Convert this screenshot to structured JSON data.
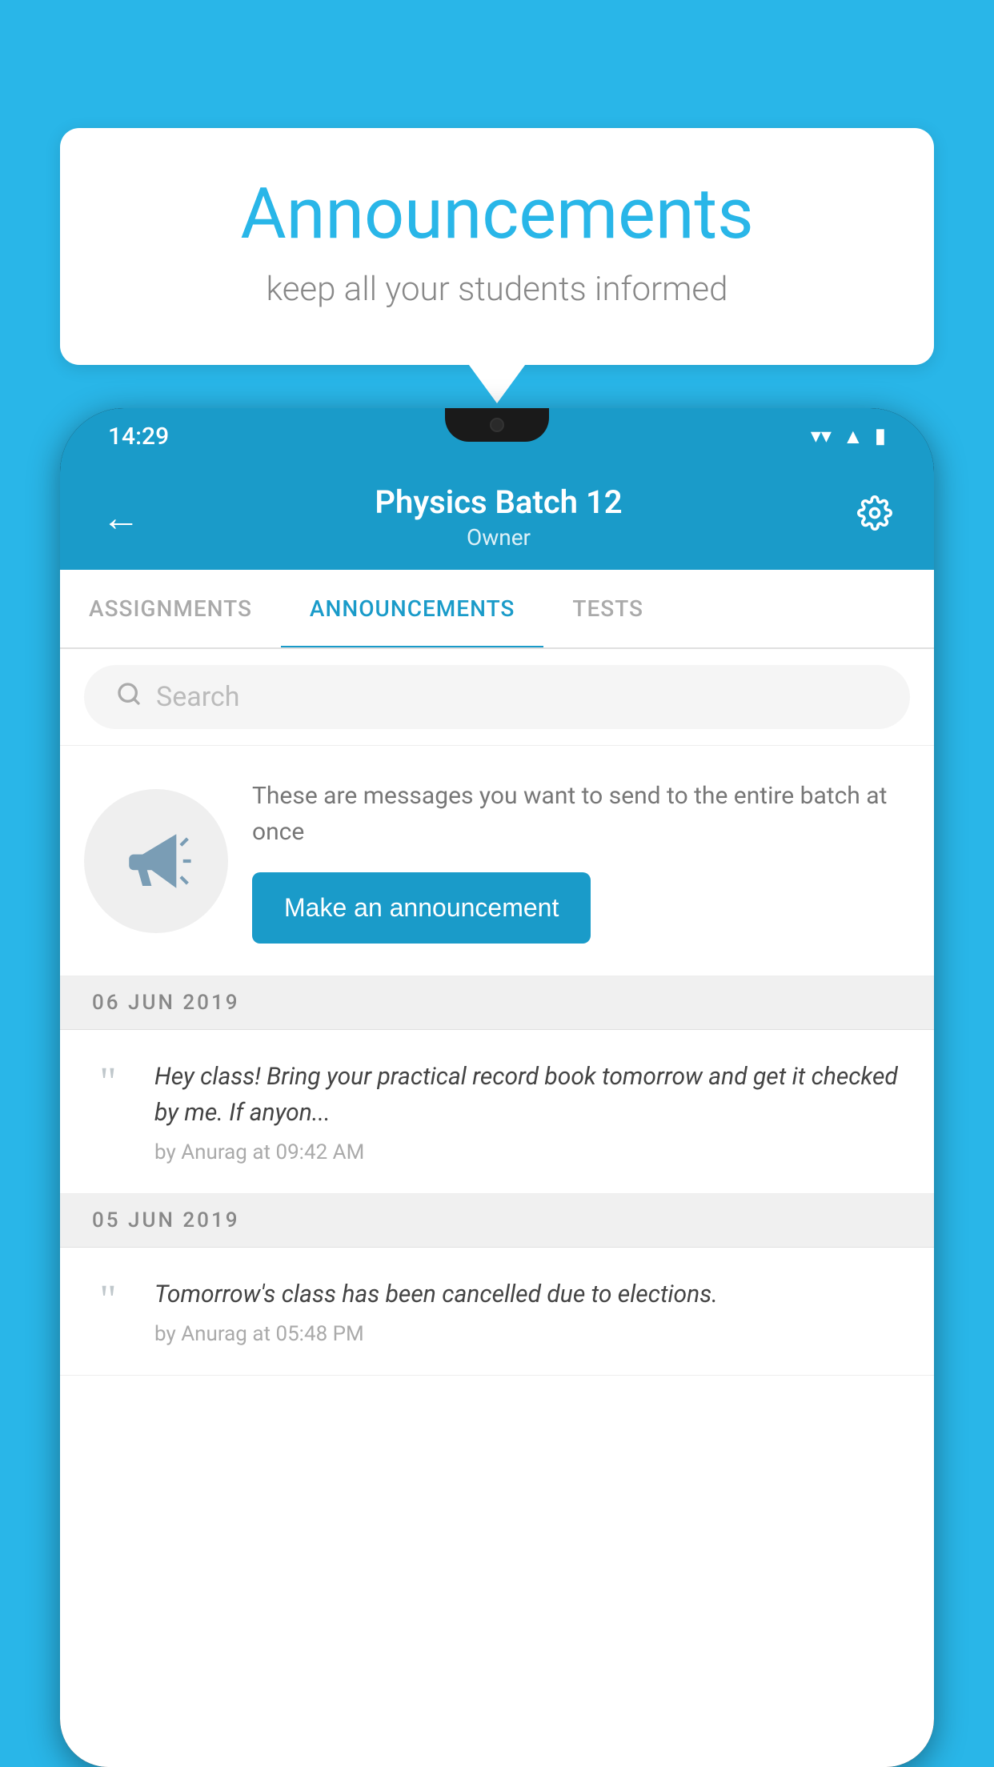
{
  "background_color": "#29b6e8",
  "speech_bubble": {
    "title": "Announcements",
    "subtitle": "keep all your students informed"
  },
  "phone": {
    "status_bar": {
      "time": "14:29",
      "icons": [
        "wifi",
        "signal",
        "battery"
      ]
    },
    "header": {
      "title": "Physics Batch 12",
      "subtitle": "Owner",
      "back_label": "←",
      "settings_label": "⚙"
    },
    "tabs": [
      {
        "label": "ASSIGNMENTS",
        "active": false
      },
      {
        "label": "ANNOUNCEMENTS",
        "active": true
      },
      {
        "label": "TESTS",
        "active": false
      }
    ],
    "search": {
      "placeholder": "Search"
    },
    "promo": {
      "description": "These are messages you want to send to the entire batch at once",
      "button_label": "Make an announcement"
    },
    "announcements": [
      {
        "date": "06  JUN  2019",
        "text": "Hey class! Bring your practical record book tomorrow and get it checked by me. If anyon...",
        "meta": "by Anurag at 09:42 AM"
      },
      {
        "date": "05  JUN  2019",
        "text": "Tomorrow's class has been cancelled due to elections.",
        "meta": "by Anurag at 05:48 PM"
      }
    ]
  }
}
